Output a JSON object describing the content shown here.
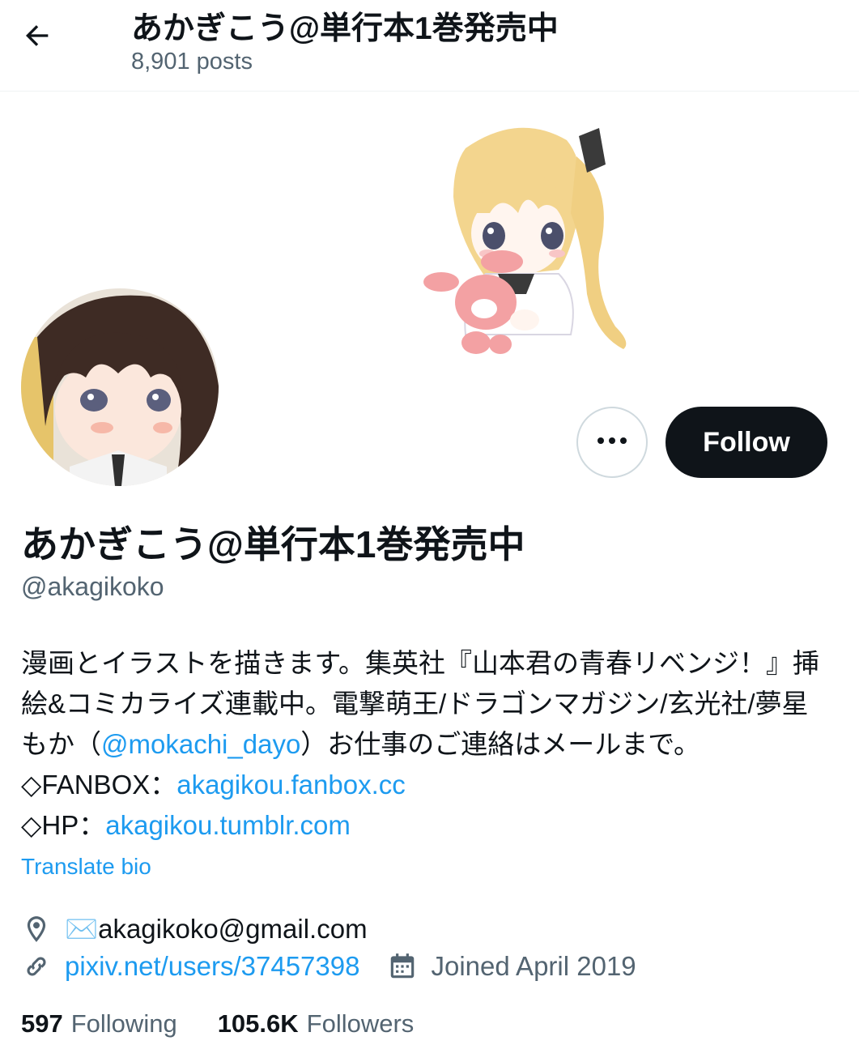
{
  "header": {
    "title": "あかぎこう@単行本1巻発売中",
    "posts": "8,901 posts"
  },
  "profile": {
    "display_name": "あかぎこう@単行本1巻発売中",
    "handle": "@akagikoko",
    "bio": {
      "part1": "漫画とイラストを描きます。集英社『山本君の青春リベンジ！』挿絵&コミカライズ連載中。電撃萌王/ドラゴンマガジン/玄光社/夢星もか（",
      "mention": "@mokachi_dayo",
      "part2": "）お仕事のご連絡はメールまで。◇FANBOX：",
      "fanbox_link": "akagikou.fanbox.cc",
      "part3": "◇HP：",
      "hp_link": "akagikou.tumblr.com"
    },
    "translate_label": "Translate bio",
    "location": "✉️akagikoko@gmail.com",
    "website": "pixiv.net/users/37457398",
    "joined": "Joined April 2019",
    "following_count": "597",
    "following_label": "Following",
    "followers_count": "105.6K",
    "followers_label": "Followers"
  },
  "actions": {
    "more_label": "•••",
    "follow_label": "Follow"
  },
  "colors": {
    "accent": "#1d9bf0",
    "text": "#0f1419",
    "secondary": "#536471",
    "follow_bg": "#0f1419"
  }
}
